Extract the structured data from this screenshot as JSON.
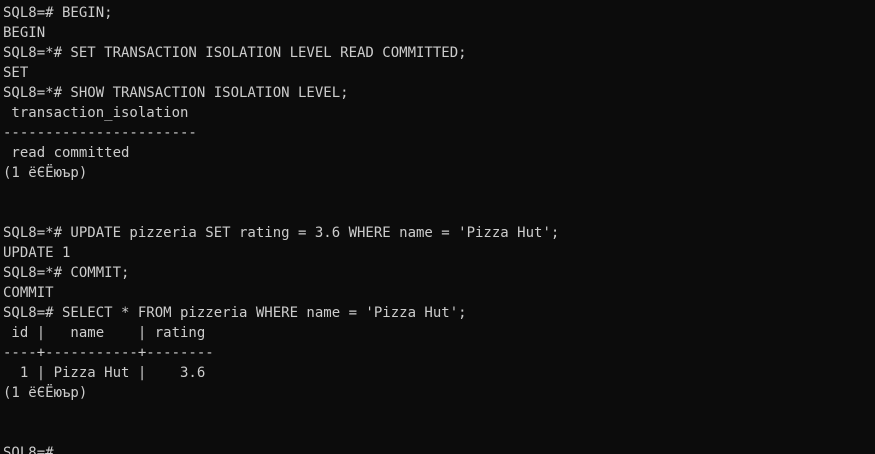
{
  "terminal": {
    "lines": [
      "SQL8=# BEGIN;",
      "BEGIN",
      "SQL8=*# SET TRANSACTION ISOLATION LEVEL READ COMMITTED;",
      "SET",
      "SQL8=*# SHOW TRANSACTION ISOLATION LEVEL;",
      " transaction_isolation",
      "-----------------------",
      " read committed",
      "(1 ёЄЁюър)",
      "",
      "",
      "SQL8=*# UPDATE pizzeria SET rating = 3.6 WHERE name = 'Pizza Hut';",
      "UPDATE 1",
      "SQL8=*# COMMIT;",
      "COMMIT",
      "SQL8=# SELECT * FROM pizzeria WHERE name = 'Pizza Hut';",
      " id |   name    | rating",
      "----+-----------+--------",
      "  1 | Pizza Hut |    3.6",
      "(1 ёЄЁюър)",
      "",
      "",
      "SQL8=#"
    ]
  }
}
